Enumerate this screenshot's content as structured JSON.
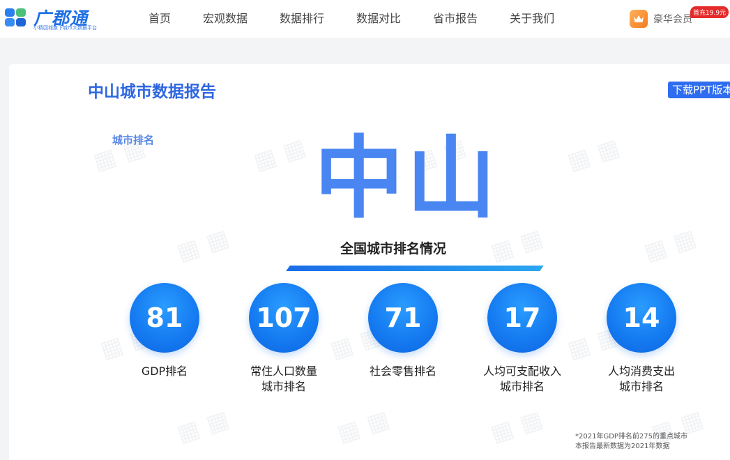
{
  "header": {
    "logo_text": "广郡通",
    "logo_sub": "小精回城旗下城市大数据平台",
    "nav": [
      "首页",
      "宏观数据",
      "数据排行",
      "数据对比",
      "省市报告",
      "关于我们"
    ],
    "vip_label": "豪华会员",
    "vip_badge": "首充19.9元",
    "accent": "#1f6fe6"
  },
  "report": {
    "title": "中山城市数据报告",
    "ppt_button": "下载PPT版本",
    "section_label": "城市排名",
    "city": "中山",
    "subtitle": "全国城市排名情况",
    "ranks": [
      {
        "value": "81",
        "label": [
          "GDP排名"
        ]
      },
      {
        "value": "107",
        "label": [
          "常住人口数量",
          "城市排名"
        ]
      },
      {
        "value": "71",
        "label": [
          "社会零售排名"
        ]
      },
      {
        "value": "17",
        "label": [
          "人均可支配收入",
          "城市排名"
        ]
      },
      {
        "value": "14",
        "label": [
          "人均消费支出",
          "城市排名"
        ]
      }
    ],
    "footnote": [
      "*2021年GDP排名前275的重点城市",
      "本报告最新数据为2021年数据"
    ]
  }
}
